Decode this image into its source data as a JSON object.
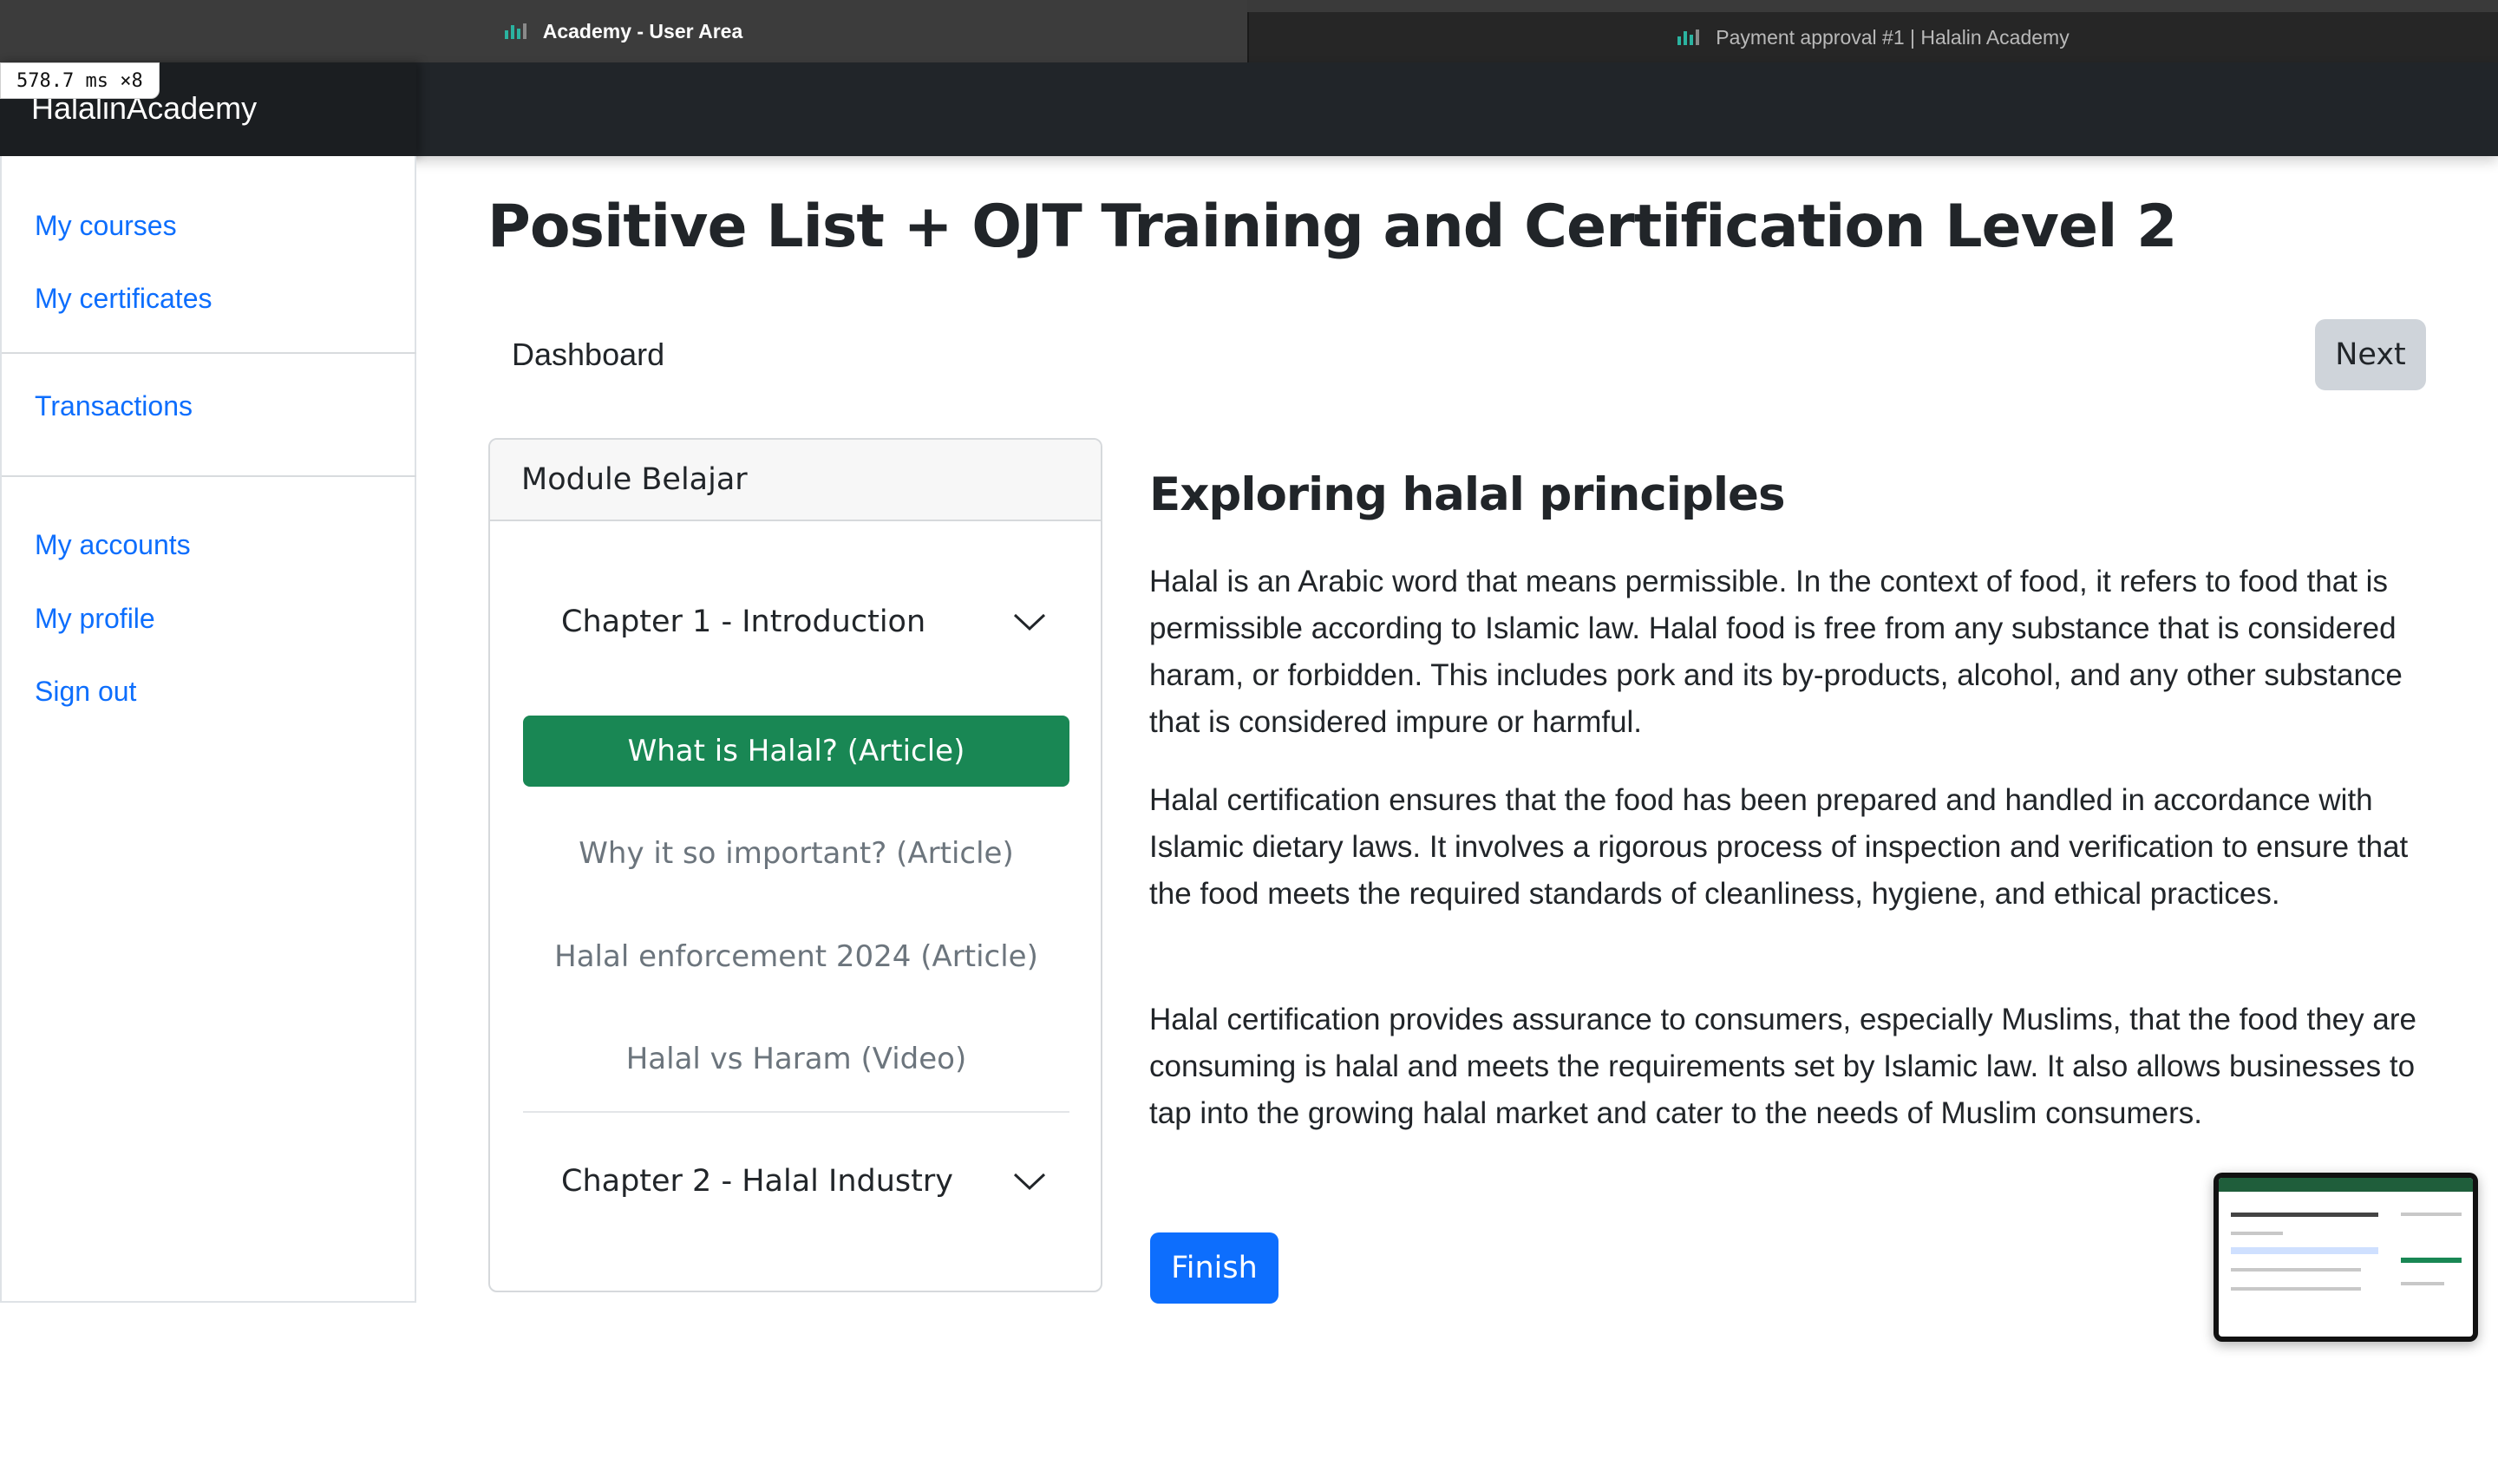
{
  "browser": {
    "tabs": [
      {
        "title": "Academy - User Area",
        "active": true
      },
      {
        "title": "Payment approval #1 | Halalin Academy",
        "active": false
      }
    ]
  },
  "perf_badge": "578.7 ms ×8",
  "navbar": {
    "brand": "HalalinAcademy"
  },
  "sidebar": {
    "groups": [
      {
        "items": [
          "My courses",
          "My certificates"
        ]
      },
      {
        "items": [
          "Transactions"
        ]
      },
      {
        "items": [
          "My accounts",
          "My profile",
          "Sign out"
        ]
      }
    ]
  },
  "main": {
    "title": "Positive List + OJT Training and Certification Level 2",
    "breadcrumb": "Dashboard",
    "next_label": "Next",
    "module": {
      "header": "Module Belajar",
      "chapters": [
        {
          "title": "Chapter 1 - Introduction",
          "expanded": true,
          "lessons": [
            {
              "label": "What is Halal? (Article)",
              "active": true
            },
            {
              "label": "Why it so important? (Article)",
              "active": false
            },
            {
              "label": "Halal enforcement 2024 (Article)",
              "active": false
            },
            {
              "label": "Halal vs Haram (Video)",
              "active": false
            }
          ]
        },
        {
          "title": "Chapter 2 - Halal Industry",
          "expanded": false,
          "lessons": []
        }
      ]
    },
    "article": {
      "title": "Exploring halal principles",
      "paragraphs": [
        "Halal is an Arabic word that means permissible. In the context of food, it refers to food that is permissible according to Islamic law. Halal food is free from any substance that is considered haram, or forbidden. This includes pork and its by-products, alcohol, and any other substance that is considered impure or harmful.",
        "Halal certification ensures that the food has been prepared and handled in accordance with Islamic dietary laws. It involves a rigorous process of inspection and verification to ensure that the food meets the required standards of cleanliness, hygiene, and ethical practices.",
        "Halal certification provides assurance to consumers, especially Muslims, that the food they are consuming is halal and meets the requirements set by Islamic law. It also allows businesses to tap into the growing halal market and cater to the needs of Muslim consumers."
      ],
      "finish_label": "Finish"
    }
  },
  "colors": {
    "primary": "#0d6efd",
    "success": "#198754",
    "navbar": "#212529",
    "secondary_btn": "#cfd4da"
  }
}
